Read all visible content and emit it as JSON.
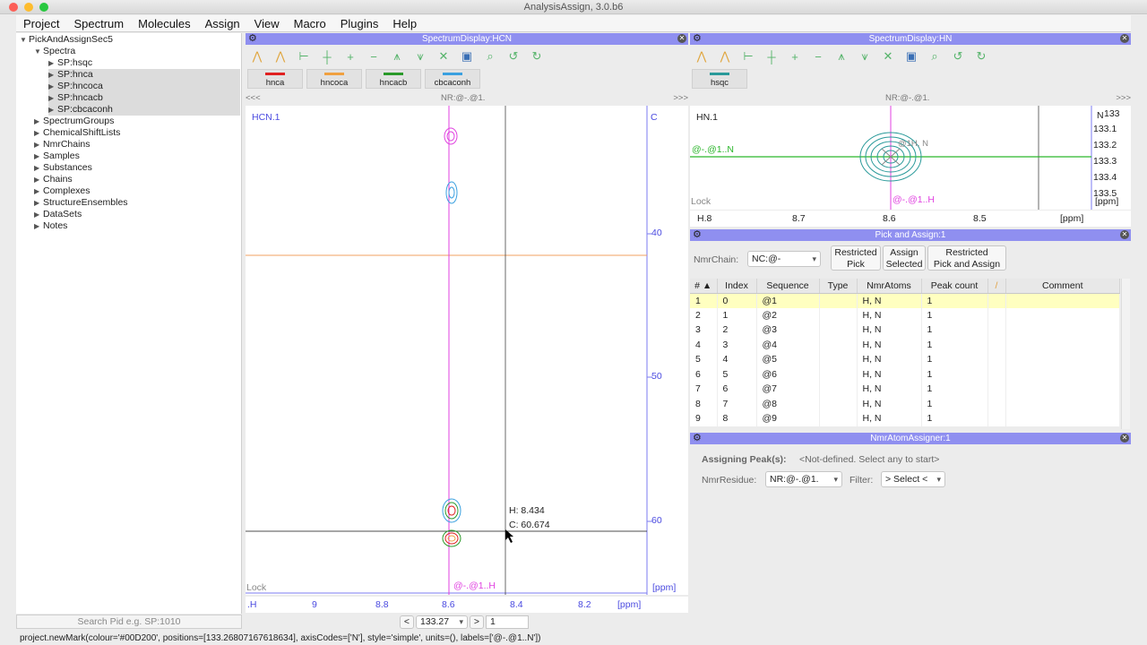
{
  "window": {
    "title": "AnalysisAssign, 3.0.b6"
  },
  "menu": [
    "Project",
    "Spectrum",
    "Molecules",
    "Assign",
    "View",
    "Macro",
    "Plugins",
    "Help"
  ],
  "sidebar": {
    "root": "PickAndAssignSec5",
    "spectra_label": "Spectra",
    "spectra": [
      "SP:hsqc",
      "SP:hnca",
      "SP:hncoca",
      "SP:hncacb",
      "SP:cbcaconh"
    ],
    "groups": [
      "SpectrumGroups",
      "ChemicalShiftLists",
      "NmrChains",
      "Samples",
      "Substances",
      "Chains",
      "Complexes",
      "StructureEnsembles",
      "DataSets",
      "Notes"
    ],
    "search_placeholder": "Search Pid e.g. SP:1010"
  },
  "left_display": {
    "title": "SpectrumDisplay:HCN",
    "spectra": [
      {
        "name": "hnca",
        "color": "#e02020"
      },
      {
        "name": "hncoca",
        "color": "#f0a040"
      },
      {
        "name": "hncacb",
        "color": "#2a9a2a"
      },
      {
        "name": "cbcaconh",
        "color": "#3aa0e0"
      }
    ],
    "nav_left": "<<<",
    "nav_right": ">>>",
    "strip": "NR:@-.@1.",
    "plot_label": "HCN.1",
    "axis_code": "C",
    "y_ticks": [
      "40",
      "50",
      "60"
    ],
    "y_unit": "[ppm]",
    "x_ticks": [
      ".H",
      "9",
      "8.8",
      "8.6",
      "8.4",
      "8.2"
    ],
    "x_unit": "[ppm]",
    "lock": "Lock",
    "cursor_h": "H: 8.434",
    "cursor_c": "C: 60.674",
    "peak_label": "@-.@1..H",
    "position_value": "133.27",
    "plane_value": "1",
    "prev": "<",
    "next": ">"
  },
  "right_display": {
    "title": "SpectrumDisplay:HN",
    "spectra": [
      {
        "name": "hsqc",
        "color": "#2a9a9a"
      }
    ],
    "nav_right": ">>>",
    "strip": "NR:@-.@1.",
    "plot_label": "HN.1",
    "axis_code": "N",
    "y_ticks": [
      "133",
      "133.1",
      "133.2",
      "133.3",
      "133.4",
      "133.5"
    ],
    "y_unit": "[ppm]",
    "x_ticks": [
      "H.8",
      "8.7",
      "8.6",
      "8.5"
    ],
    "x_unit": "[ppm]",
    "lock": "Lock",
    "n_label": "@-.@1..N",
    "peak_tag": "@1H, N",
    "h_label": "@-.@1..H"
  },
  "pick_assign": {
    "title": "Pick and Assign:1",
    "nmrchain_label": "NmrChain:",
    "nmrchain_value": "NC:@-",
    "btn_restricted_pick": [
      "Restricted",
      "Pick"
    ],
    "btn_assign_selected": [
      "Assign",
      "Selected"
    ],
    "btn_restricted_pick_assign": [
      "Restricted",
      "Pick and Assign"
    ],
    "columns": [
      "#",
      "Index",
      "Sequence",
      "Type",
      "NmrAtoms",
      "Peak count",
      "/",
      "Comment"
    ],
    "rows": [
      [
        "1",
        "0",
        "@1",
        "",
        "H, N",
        "1",
        "",
        ""
      ],
      [
        "2",
        "1",
        "@2",
        "",
        "H, N",
        "1",
        "",
        ""
      ],
      [
        "3",
        "2",
        "@3",
        "",
        "H, N",
        "1",
        "",
        ""
      ],
      [
        "4",
        "3",
        "@4",
        "",
        "H, N",
        "1",
        "",
        ""
      ],
      [
        "5",
        "4",
        "@5",
        "",
        "H, N",
        "1",
        "",
        ""
      ],
      [
        "6",
        "5",
        "@6",
        "",
        "H, N",
        "1",
        "",
        ""
      ],
      [
        "7",
        "6",
        "@7",
        "",
        "H, N",
        "1",
        "",
        ""
      ],
      [
        "8",
        "7",
        "@8",
        "",
        "H, N",
        "1",
        "",
        ""
      ],
      [
        "9",
        "8",
        "@9",
        "",
        "H, N",
        "1",
        "",
        ""
      ]
    ]
  },
  "nmr_assigner": {
    "title": "NmrAtomAssigner:1",
    "assigning_label": "Assigning Peak(s):",
    "assigning_value": "<Not-defined. Select any to start>",
    "residue_label": "NmrResidue:",
    "residue_value": "NR:@-.@1.",
    "filter_label": "Filter:",
    "filter_value": "> Select <"
  },
  "status": "project.newMark(colour='#00D200', positions=[133.26807167618634], axisCodes=['N'], style='simple', units=(), labels=['@-.@1..N'])"
}
